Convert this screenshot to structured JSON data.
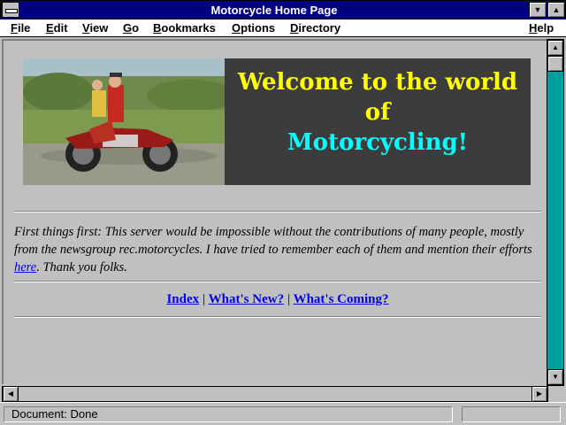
{
  "window": {
    "title": "Motorcycle Home Page"
  },
  "menubar": {
    "file": {
      "key": "F",
      "rest": "ile"
    },
    "edit": {
      "key": "E",
      "rest": "dit"
    },
    "view": {
      "key": "V",
      "rest": "iew"
    },
    "go": {
      "key": "G",
      "rest": "o"
    },
    "bookmarks": {
      "key": "B",
      "rest": "ookmarks"
    },
    "options": {
      "key": "O",
      "rest": "ptions"
    },
    "directory": {
      "key": "D",
      "rest": "irectory"
    },
    "help": {
      "key": "H",
      "rest": "elp"
    }
  },
  "banner": {
    "line1": "Welcome to the world",
    "line2": "of",
    "line3": "Motorcycling!",
    "line1_color": "#ffff00",
    "line3_color": "#00ffff",
    "background": "#3c3c3c"
  },
  "intro": {
    "text_before_link": "First things first: This server would be impossible without the contributions of many people, mostly from the newsgroup rec.motorcycles. I have tried to remember each of them and mention their efforts ",
    "link": "here",
    "text_after_link": ". Thank you folks."
  },
  "nav": {
    "index": "Index",
    "whats_new": "What's New?",
    "whats_coming": "What's Coming?",
    "separator": "|"
  },
  "status": {
    "text": "Document: Done"
  },
  "colors": {
    "titlebar": "#000080",
    "link": "#0000ee",
    "scroll_track": "#00a0a0"
  }
}
